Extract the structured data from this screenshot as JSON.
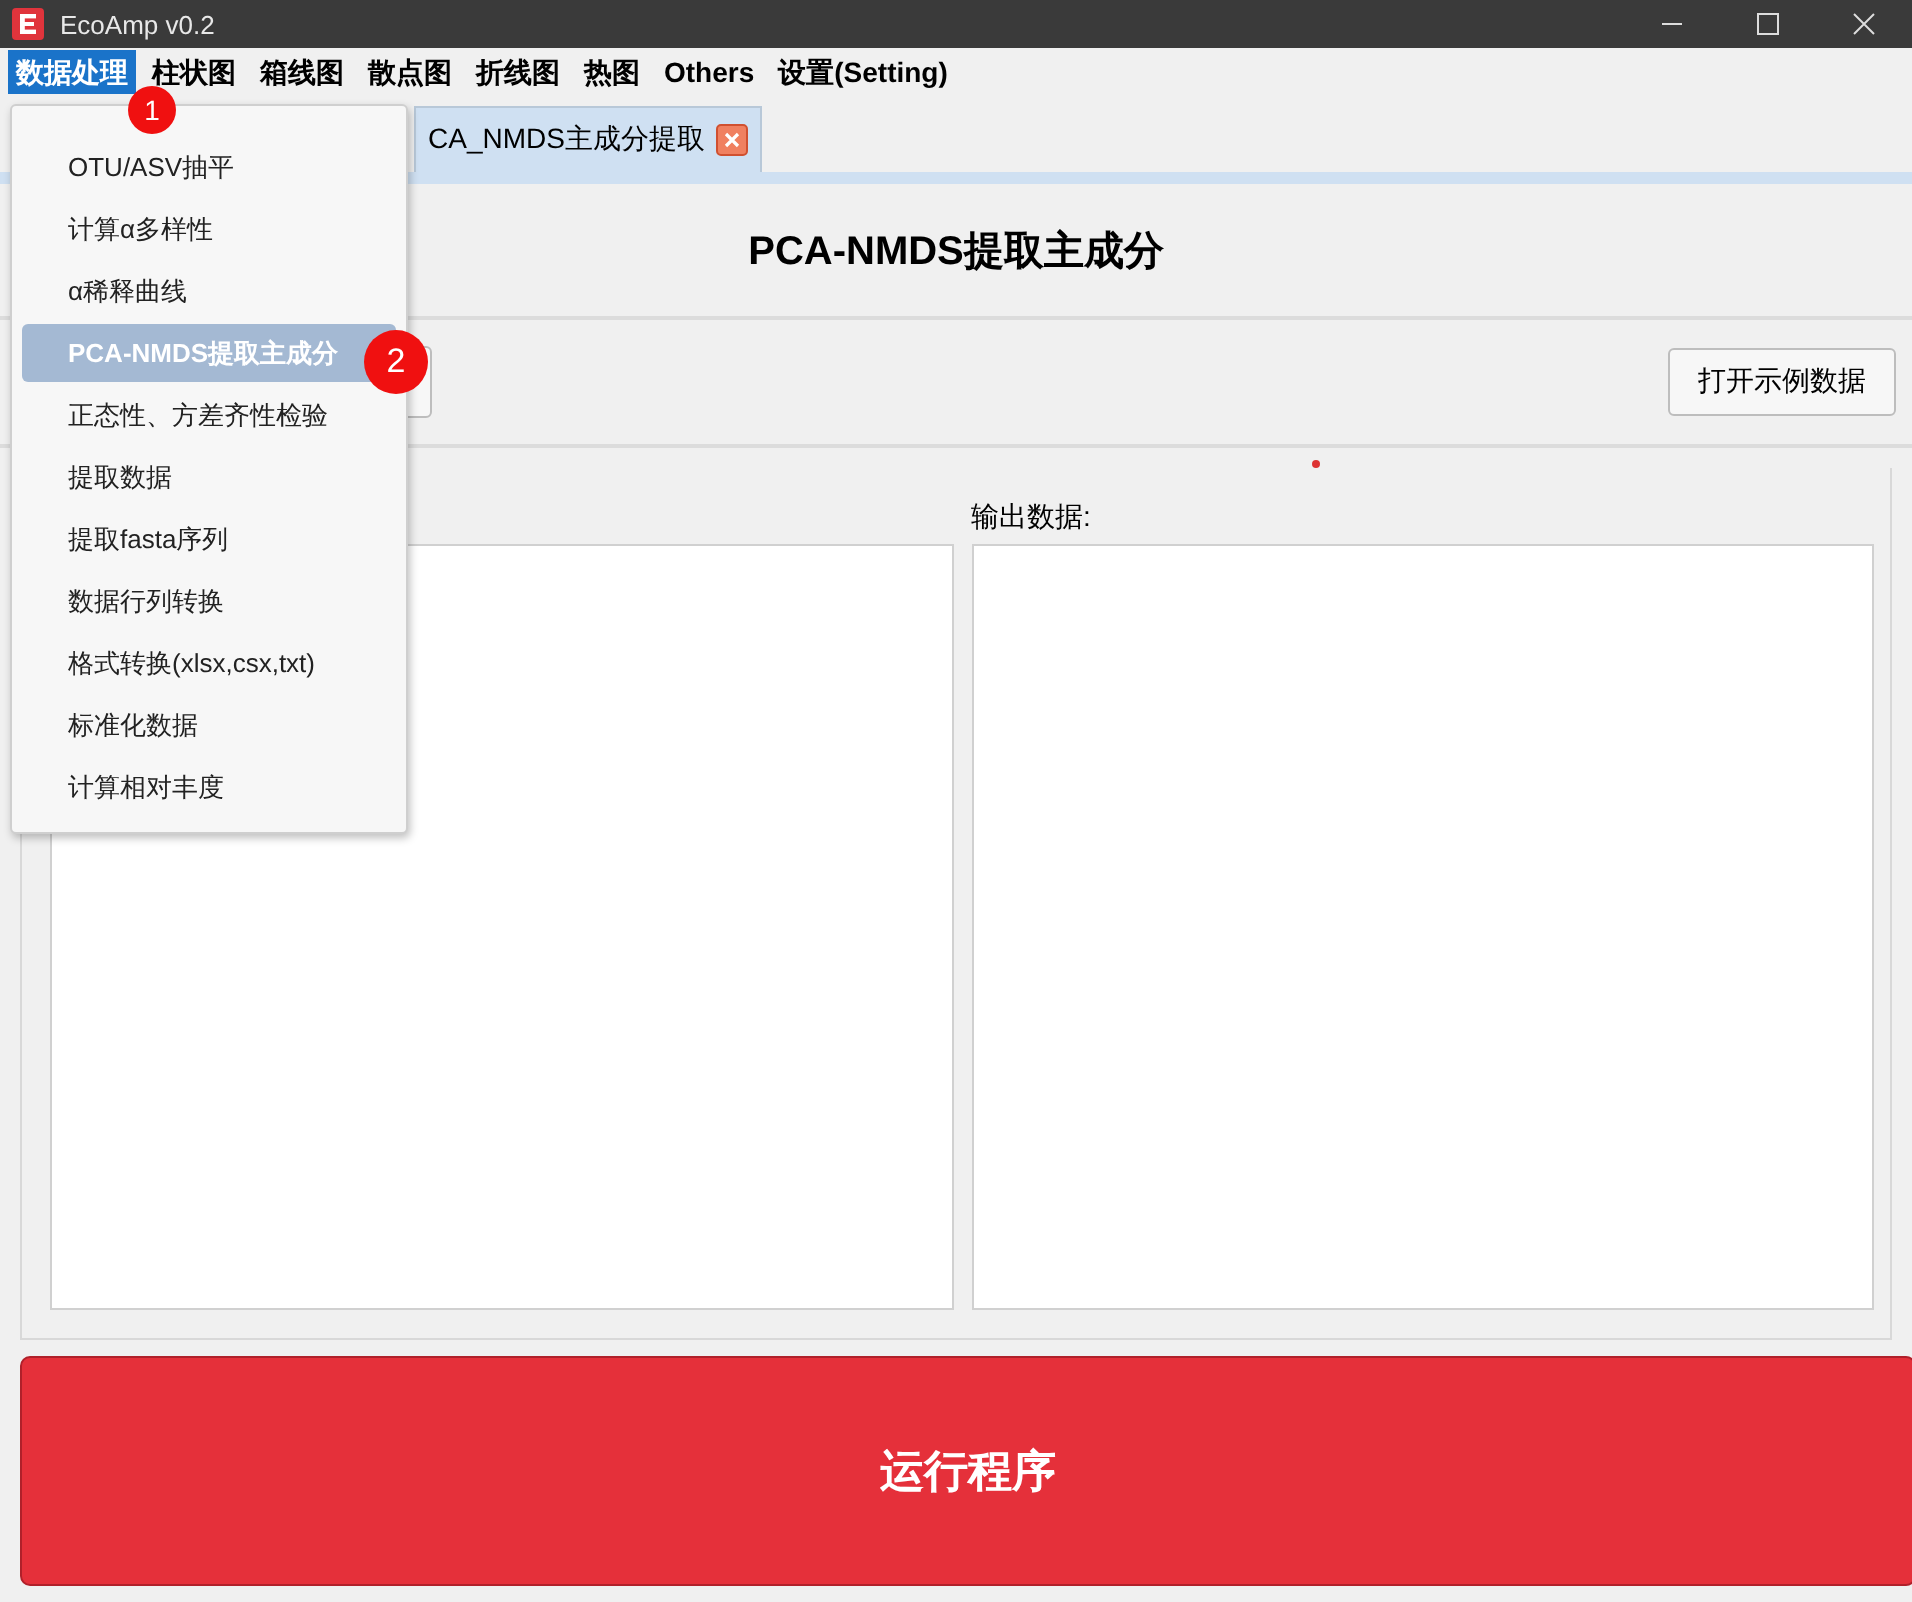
{
  "window": {
    "title": "EcoAmp v0.2"
  },
  "menu_bar": [
    {
      "label": "数据处理",
      "selected": true
    },
    {
      "label": "柱状图",
      "selected": false
    },
    {
      "label": "箱线图",
      "selected": false
    },
    {
      "label": "散点图",
      "selected": false
    },
    {
      "label": "折线图",
      "selected": false
    },
    {
      "label": "热图",
      "selected": false
    },
    {
      "label": "Others",
      "selected": false
    },
    {
      "label": "设置(Setting)",
      "selected": false
    }
  ],
  "tabs": [
    {
      "label": "CA_NMDS主成分提取",
      "selected": true
    }
  ],
  "dropdown": [
    {
      "label": "OTU/ASV抽平",
      "selected": false
    },
    {
      "label": "计算α多样性",
      "selected": false
    },
    {
      "label": "α稀释曲线",
      "selected": false
    },
    {
      "label": "PCA-NMDS提取主成分",
      "selected": true
    },
    {
      "label": "正态性、方差齐性检验",
      "selected": false
    },
    {
      "label": "提取数据",
      "selected": false
    },
    {
      "label": "提取fasta序列",
      "selected": false
    },
    {
      "label": "数据行列转换",
      "selected": false
    },
    {
      "label": "格式转换(xlsx,csx,txt)",
      "selected": false
    },
    {
      "label": "标准化数据",
      "selected": false
    },
    {
      "label": "计算相对丰度",
      "selected": false
    }
  ],
  "annotations": [
    {
      "label": "1"
    },
    {
      "label": "2"
    }
  ],
  "page_title": "PCA-NMDS提取主成分",
  "example_button": "打开示例数据",
  "output_label": "输出数据:",
  "run_button": "运行程序"
}
